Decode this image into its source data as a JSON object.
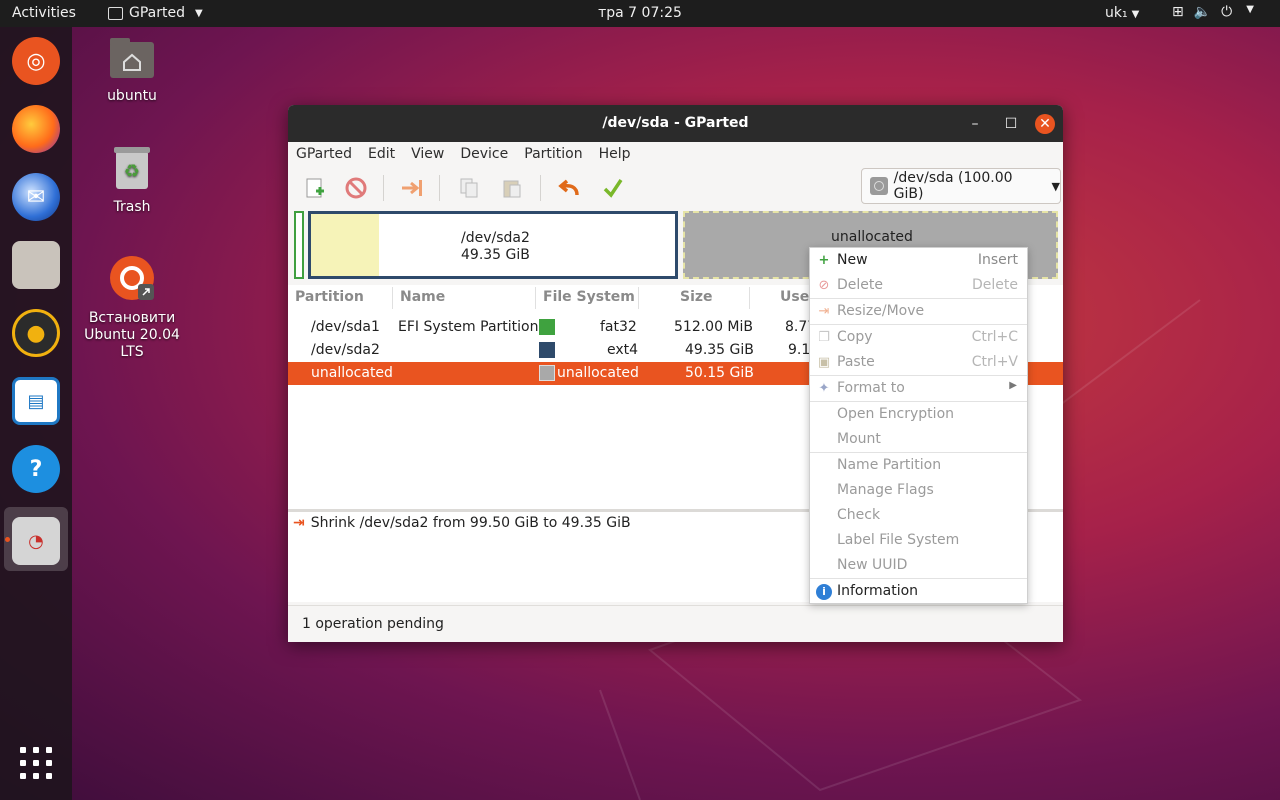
{
  "topbar": {
    "activities": "Activities",
    "app_name": "GParted",
    "clock": "тра 7  07:25",
    "keyboard": "uk₁"
  },
  "desktop": {
    "home_label": "ubuntu",
    "trash_label": "Trash",
    "install_label": "Встановити Ubuntu 20.04 LTS"
  },
  "window": {
    "title": "/dev/sda - GParted",
    "menu": [
      "GParted",
      "Edit",
      "View",
      "Device",
      "Partition",
      "Help"
    ],
    "device_combo": "/dev/sda (100.00 GiB)"
  },
  "graph": {
    "sda2_name": "/dev/sda2",
    "sda2_size": "49.35 GiB",
    "unallocated": "unallocated"
  },
  "table": {
    "headers": [
      "Partition",
      "Name",
      "File System",
      "Size",
      "Used"
    ],
    "rows": [
      {
        "partition": "/dev/sda1",
        "name": "EFI System Partition",
        "fs": "fat32",
        "size": "512.00 MiB",
        "used": "8.77",
        "color": "#3fa23f"
      },
      {
        "partition": "/dev/sda2",
        "name": "",
        "fs": "ext4",
        "size": "49.35 GiB",
        "used": "9.1",
        "color": "#2e4a6b"
      },
      {
        "partition": "unallocated",
        "name": "",
        "fs": "unallocated",
        "size": "50.15 GiB",
        "used": "",
        "color": "#a9a9a9"
      }
    ]
  },
  "operations": {
    "items": [
      "Shrink /dev/sda2 from 99.50 GiB to 49.35 GiB"
    ],
    "status": "1 operation pending"
  },
  "context_menu": {
    "new": "New",
    "new_acc": "Insert",
    "delete": "Delete",
    "delete_acc": "Delete",
    "resize": "Resize/Move",
    "copy": "Copy",
    "copy_acc": "Ctrl+C",
    "paste": "Paste",
    "paste_acc": "Ctrl+V",
    "format": "Format to",
    "open_encryption": "Open Encryption",
    "mount": "Mount",
    "name_partition": "Name Partition",
    "manage_flags": "Manage Flags",
    "check": "Check",
    "label_fs": "Label File System",
    "new_uuid": "New UUID",
    "information": "Information"
  },
  "colors": {
    "accent": "#e95420",
    "ext4": "#2e4a6b",
    "fat32": "#3fa23f",
    "unallocated": "#a9a9a9"
  }
}
